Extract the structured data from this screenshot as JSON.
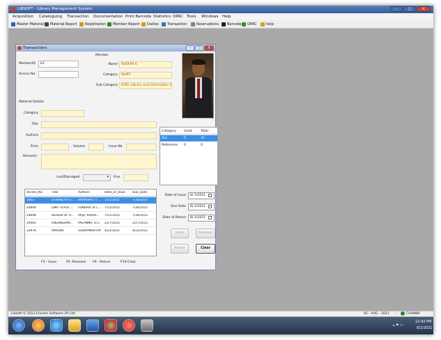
{
  "window": {
    "title": "LIBSOFT - Library Management System",
    "controls": [
      "–",
      "□",
      "X"
    ]
  },
  "menu": [
    "Acquisition",
    "Cataloguing",
    "Transaction",
    "Documentation",
    "Print Barcode",
    "Statistics",
    "OPAC",
    "Tools",
    "Windows",
    "Help"
  ],
  "toolbar": [
    {
      "label": "Master Material",
      "icon": "book-icon",
      "color": "#2e5fb8"
    },
    {
      "label": "Material Report",
      "icon": "binoculars-icon",
      "color": "#444444"
    },
    {
      "label": "Registration",
      "icon": "user-add-icon",
      "color": "#c99a1a"
    },
    {
      "label": "Member Report",
      "icon": "members-icon",
      "color": "#3c7d3c"
    },
    {
      "label": "Dailies",
      "icon": "calendar-icon",
      "color": "#d4a017"
    },
    {
      "label": "Transaction",
      "icon": "people-transfer-icon",
      "color": "#3a6fbf"
    },
    {
      "label": "Reservations",
      "icon": "reservation-icon",
      "color": "#7f7f7f"
    },
    {
      "label": "Barcode",
      "icon": "barcode-icon",
      "color": "#222222"
    },
    {
      "label": "OPAC",
      "icon": "opac-icon",
      "color": "#3c8d3c"
    },
    {
      "label": "help",
      "icon": "help-icon",
      "color": "#d4a017"
    }
  ],
  "transactions": {
    "title": "Transactions",
    "controls": [
      "–",
      "□",
      "X"
    ],
    "member_heading": "Member",
    "member_id_label": "MemberID",
    "member_id_value": "b1",
    "access_no_label": "Access No",
    "access_no_value": "",
    "name_label": "Name",
    "name_value": "SHEKAR K",
    "category_label": "Category",
    "category_value": "Staff1",
    "subcategory_label": "Sub Category",
    "subcategory_value": "HOD, Library and Information Scien",
    "material_heading": "Material Details",
    "mat_category_label": "Category",
    "title_label": "Title",
    "authors_label": "Authors",
    "price_label": "Price",
    "volume_label": "Volume",
    "issue_no_label": "Issue No",
    "remarks_label": "Remarks",
    "lost_damaged_label": "Lost/Damaged",
    "fine_label": "Fine",
    "category_table": {
      "headers": [
        "Category",
        "Used",
        "Total"
      ],
      "rows": [
        {
          "category": "ALL",
          "used": "5",
          "total": "10"
        },
        {
          "category": "Reference",
          "used": "0",
          "total": "0"
        }
      ]
    },
    "issue_table": {
      "headers": [
        "Access_No",
        "Title",
        "Authors",
        "Date_of_Issue",
        "Due_Date"
      ],
      "rows": [
        {
          "access_no": "1802",
          "title": "STRENGTH O...",
          "authors": "BHANSKATTI, ...",
          "issue": "7/15/2015",
          "due": "7/30/2015"
        },
        {
          "access_no": "24894",
          "title": "LIMIT STATE ...",
          "authors": "PUNDHA, B.C....",
          "issue": "7/15/2015",
          "due": "7/30/2015"
        },
        {
          "access_no": "24608",
          "title": "DESIGN OF R...",
          "authors": "RAJU, KRISH...",
          "issue": "7/15/2015",
          "due": "7/30/2015"
        },
        {
          "access_no": "29063",
          "title": "ENGINEERIN...",
          "authors": "PALANNA, O.G.",
          "issue": "2/27/2015",
          "due": "2/27/2015"
        },
        {
          "access_no": "33978",
          "title": "PARIDHI",
          "authors": "SUDHAMURTHY",
          "issue": "4/22/2021",
          "due": "4/22/2021"
        }
      ]
    },
    "date_of_issue_label": "Date of Issue",
    "date_of_issue_value": "8/ 2/2021",
    "due_date_label": "Due Date",
    "due_date_value": "8/ 2/2021",
    "date_of_return_label": "Date of Return",
    "date_of_return_value": "8/ 2/2021",
    "issue_button": "Issue",
    "renewal_button": "Renewal",
    "return_button": "Return",
    "clear_button": "Clear",
    "shortcuts": [
      "F3 - Issue",
      "F6 -Renewal",
      "F9 - Return",
      "F10-Clear"
    ]
  },
  "statusbar": {
    "left": "Libsoft © 2013 Environ Software (P) Ltd.",
    "date": "02 - AUG - 2021",
    "user": "CHANNA"
  },
  "taskbar": {
    "time": "12:42 PM",
    "date": "8/2/2021"
  }
}
